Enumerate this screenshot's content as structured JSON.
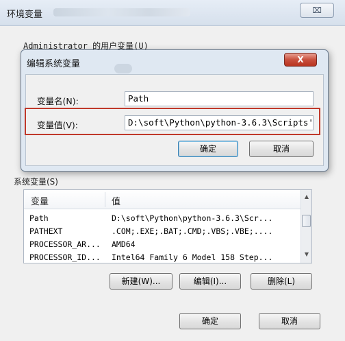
{
  "outer_window": {
    "title": "环境变量",
    "close_glyph": "⌧",
    "user_vars_label": "Administrator 的用户变量(U)",
    "sys_vars_label": "系统变量(S)"
  },
  "dialog": {
    "title": "编辑系统变量",
    "close_glyph": "X",
    "name_label": "变量名(N):",
    "name_value": "Path",
    "value_label": "变量值(V):",
    "value_value": "D:\\soft\\Python\\python-3.6.3\\Scripts'",
    "ok": "确定",
    "cancel": "取消"
  },
  "sys_table": {
    "headers": [
      "变量",
      "值"
    ],
    "rows": [
      {
        "name": "Path",
        "value": "D:\\soft\\Python\\python-3.6.3\\Scr..."
      },
      {
        "name": "PATHEXT",
        "value": ".COM;.EXE;.BAT;.CMD;.VBS;.VBE;...."
      },
      {
        "name": "PROCESSOR_AR...",
        "value": "AMD64"
      },
      {
        "name": "PROCESSOR_ID...",
        "value": "Intel64 Family 6 Model 158 Step..."
      }
    ]
  },
  "sys_buttons": {
    "new": "新建(W)...",
    "edit": "编辑(I)...",
    "delete": "删除(L)"
  },
  "footer_buttons": {
    "ok": "确定",
    "cancel": "取消"
  },
  "colors": {
    "highlight": "#c0392b",
    "close_red": "#c9503e"
  }
}
